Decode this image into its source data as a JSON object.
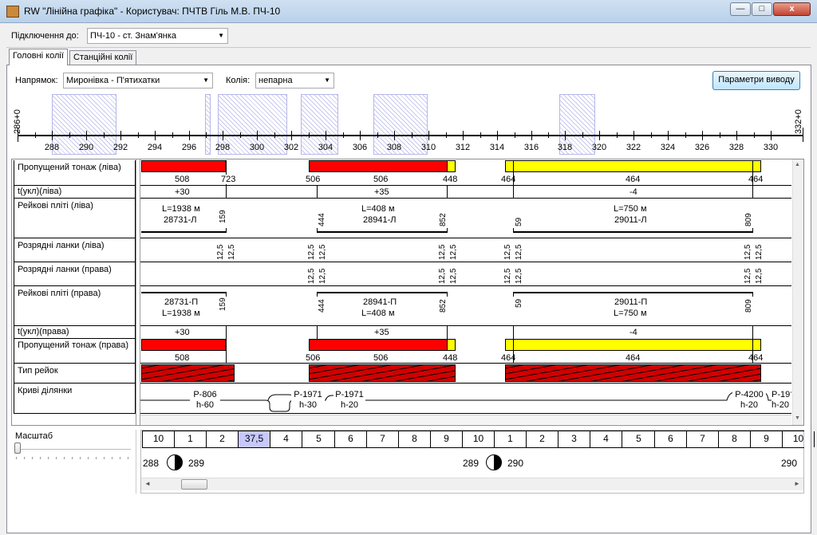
{
  "window": {
    "title": "RW \"Лінійна графіка\" - Користувач: ПЧТВ Гіль М.В. ПЧ-10",
    "min_label": "—",
    "max_label": "□",
    "close_label": "x"
  },
  "connection": {
    "label": "Підключення до:",
    "value": "ПЧ-10 - ст. Знам'янка"
  },
  "tabs": [
    {
      "label": "Головні колії"
    },
    {
      "label": "Станційні колії"
    }
  ],
  "filters": {
    "direction_label": "Напрямок:",
    "direction_value": "Миронівка - П'ятихатки",
    "track_label": "Колія:",
    "track_value": "непарна",
    "output_params_button": "Параметри виводу"
  },
  "ruler": {
    "start": "286+0",
    "end": "332+0",
    "ticks": [
      "288",
      "290",
      "292",
      "294",
      "296",
      "298",
      "300",
      "302",
      "304",
      "306",
      "308",
      "310",
      "312",
      "314",
      "316",
      "318",
      "320",
      "322",
      "324",
      "326",
      "328",
      "330"
    ]
  },
  "rows": {
    "tonnage_left": "Пропущений тонаж (ліва)",
    "t_left": "t(укл)(ліва)",
    "slabs_left": "Рейкові пліті (ліва)",
    "joints_left": "Розрядні ланки (ліва)",
    "joints_right": "Розрядні ланки (права)",
    "slabs_right": "Рейкові пліті (права)",
    "t_right": "t(укл)(права)",
    "tonnage_right": "Пропущений тонаж (права)",
    "rail_type": "Тип рейок",
    "curves": "Криві ділянки"
  },
  "tonnage": {
    "left": [
      "508",
      "723",
      "506",
      "506",
      "448",
      "464",
      "464",
      "464"
    ],
    "right": [
      "508",
      "506",
      "506",
      "448",
      "464",
      "464",
      "464"
    ]
  },
  "t_values": [
    "+30",
    "+35",
    "-4"
  ],
  "slabs_left": [
    {
      "len": "L=1938 м",
      "id": "28731-Л",
      "end": "159"
    },
    {
      "start": "444",
      "len": "L=408 м",
      "id": "28941-Л",
      "end": "852"
    },
    {
      "start": "59",
      "len": "L=750 м",
      "id": "29011-Л",
      "end": "809"
    }
  ],
  "slabs_right": [
    {
      "len": "L=1938 м",
      "id": "28731-П",
      "end": "159"
    },
    {
      "start": "444",
      "len": "L=408 м",
      "id": "28941-П",
      "end": "852"
    },
    {
      "start": "59",
      "len": "L=750 м",
      "id": "29011-П",
      "end": "809"
    }
  ],
  "joint_value": "12,5",
  "curves": [
    {
      "r": "Р-806",
      "h": "h-60"
    },
    {
      "r": "Р-1971",
      "h": "h-30"
    },
    {
      "r": "Р-1971",
      "h": "h-20"
    },
    {
      "r": "Р-4200",
      "h": "h-20"
    },
    {
      "r": "Р-19",
      "h": "h-20"
    }
  ],
  "scale_label": "Масштаб",
  "pickets": [
    "10",
    "1",
    "2",
    "37,5",
    "4",
    "5",
    "6",
    "7",
    "8",
    "9",
    "10",
    "1",
    "2",
    "3",
    "4",
    "5",
    "6",
    "7",
    "8",
    "9",
    "10"
  ],
  "km_marks": [
    {
      "left": "288",
      "right": "289"
    },
    {
      "left": "289",
      "right": "290"
    },
    {
      "left": "",
      "right": "290"
    }
  ],
  "scroll": {
    "left_arrow": "◄",
    "right_arrow": "►"
  }
}
